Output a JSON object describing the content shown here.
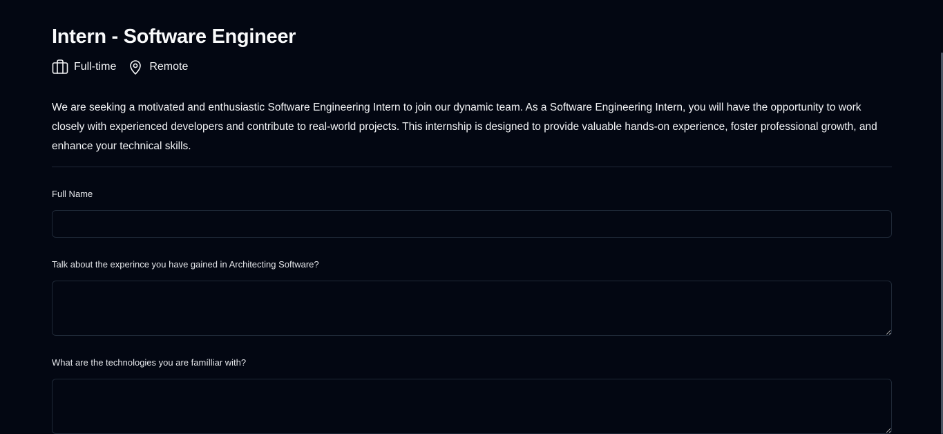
{
  "job": {
    "title": "Intern - Software Engineer",
    "employment_type": "Full-time",
    "location": "Remote",
    "description": "We are seeking a motivated and enthusiastic Software Engineering Intern to join our dynamic team. As a Software Engineering Intern, you will have the opportunity to work closely with experienced developers and contribute to real-world projects. This internship is designed to provide valuable hands-on experience, foster professional growth, and enhance your technical skills."
  },
  "icons": {
    "employment_type": "briefcase-icon",
    "location": "map-pin-icon"
  },
  "form": {
    "full_name": {
      "label": "Full Name",
      "value": "",
      "placeholder": ""
    },
    "architecting_experience": {
      "label": "Talk about the experince you have gained in Architecting Software?",
      "value": "",
      "placeholder": ""
    },
    "technologies": {
      "label": "What are the technologies you are famílliar with?",
      "value": "",
      "placeholder": ""
    }
  },
  "colors": {
    "background": "#030712",
    "text": "#f3f4f6",
    "border": "#1f2937"
  }
}
